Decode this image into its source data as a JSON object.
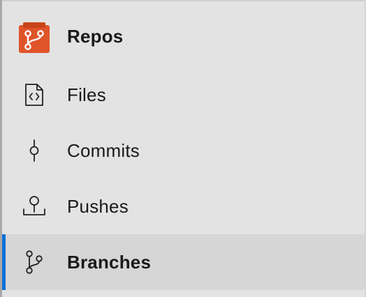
{
  "header": {
    "title": "Repos",
    "icon": "repos-app-icon",
    "brand_color": "#e0542a"
  },
  "nav": {
    "accent_color": "#0e6fd6",
    "items": [
      {
        "label": "Files",
        "icon": "file-code-icon",
        "selected": false
      },
      {
        "label": "Commits",
        "icon": "commit-icon",
        "selected": false
      },
      {
        "label": "Pushes",
        "icon": "push-icon",
        "selected": false
      },
      {
        "label": "Branches",
        "icon": "branch-icon",
        "selected": true
      }
    ]
  }
}
